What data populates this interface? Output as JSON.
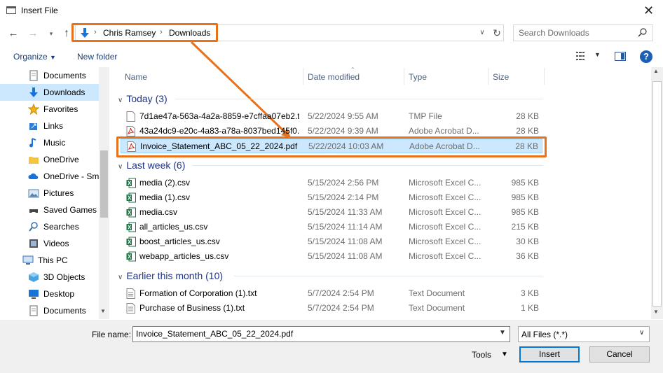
{
  "window": {
    "title": "Insert File",
    "close_glyph": "✕"
  },
  "address": {
    "crumbs": [
      "Chris Ramsey",
      "Downloads"
    ],
    "separator": "›",
    "search_placeholder": "Search Downloads"
  },
  "toolbar": {
    "organize": "Organize",
    "new_folder": "New folder"
  },
  "nav": {
    "items": [
      {
        "label": "Documents",
        "icon": "documents-icon"
      },
      {
        "label": "Downloads",
        "icon": "download-icon",
        "selected": true
      },
      {
        "label": "Favorites",
        "icon": "star-icon"
      },
      {
        "label": "Links",
        "icon": "link-icon"
      },
      {
        "label": "Music",
        "icon": "music-icon"
      },
      {
        "label": "OneDrive",
        "icon": "folder-icon"
      },
      {
        "label": "OneDrive - Sm",
        "icon": "cloud-icon"
      },
      {
        "label": "Pictures",
        "icon": "pictures-icon"
      },
      {
        "label": "Saved Games",
        "icon": "game-icon"
      },
      {
        "label": "Searches",
        "icon": "search-icon"
      },
      {
        "label": "Videos",
        "icon": "video-icon"
      },
      {
        "label": "This PC",
        "icon": "computer-icon"
      },
      {
        "label": "3D Objects",
        "icon": "cube-icon"
      },
      {
        "label": "Desktop",
        "icon": "desktop-icon"
      },
      {
        "label": "Documents",
        "icon": "documents-icon"
      }
    ]
  },
  "columns": {
    "name": "Name",
    "date": "Date modified",
    "type": "Type",
    "size": "Size"
  },
  "groups": [
    {
      "label": "Today (3)"
    },
    {
      "label": "Last week (6)"
    },
    {
      "label": "Earlier this month (10)"
    }
  ],
  "files": [
    {
      "name": "7d1ae47a-563a-4a2a-8859-e7cffaa07eb2.t...",
      "date": "5/22/2024 9:55 AM",
      "type": "TMP File",
      "size": "28 KB",
      "icon": "file-icon"
    },
    {
      "name": "43a24dc9-e20c-4a83-a78a-8037bed145f0...",
      "date": "5/22/2024 9:39 AM",
      "type": "Adobe Acrobat D...",
      "size": "28 KB",
      "icon": "pdf-icon"
    },
    {
      "name": "Invoice_Statement_ABC_05_22_2024.pdf",
      "date": "5/22/2024 10:03 AM",
      "type": "Adobe Acrobat D...",
      "size": "28 KB",
      "icon": "pdf-icon",
      "selected": true
    },
    {
      "name": "media (2).csv",
      "date": "5/15/2024 2:56 PM",
      "type": "Microsoft Excel C...",
      "size": "985 KB",
      "icon": "excel-icon"
    },
    {
      "name": "media (1).csv",
      "date": "5/15/2024 2:14 PM",
      "type": "Microsoft Excel C...",
      "size": "985 KB",
      "icon": "excel-icon"
    },
    {
      "name": "media.csv",
      "date": "5/15/2024 11:33 AM",
      "type": "Microsoft Excel C...",
      "size": "985 KB",
      "icon": "excel-icon"
    },
    {
      "name": "all_articles_us.csv",
      "date": "5/15/2024 11:14 AM",
      "type": "Microsoft Excel C...",
      "size": "215 KB",
      "icon": "excel-icon"
    },
    {
      "name": "boost_articles_us.csv",
      "date": "5/15/2024 11:08 AM",
      "type": "Microsoft Excel C...",
      "size": "30 KB",
      "icon": "excel-icon"
    },
    {
      "name": "webapp_articles_us.csv",
      "date": "5/15/2024 11:08 AM",
      "type": "Microsoft Excel C...",
      "size": "36 KB",
      "icon": "excel-icon"
    },
    {
      "name": "Formation of Corporation (1).txt",
      "date": "5/7/2024 2:54 PM",
      "type": "Text Document",
      "size": "3 KB",
      "icon": "text-file-icon"
    },
    {
      "name": "Purchase of Business (1).txt",
      "date": "5/7/2024 2:54 PM",
      "type": "Text Document",
      "size": "1 KB",
      "icon": "text-file-icon"
    }
  ],
  "footer": {
    "file_name_label": "File name:",
    "file_name_value": "Invoice_Statement_ABC_05_22_2024.pdf",
    "filter": "All Files (*.*)",
    "tools": "Tools",
    "insert": "Insert",
    "cancel": "Cancel"
  },
  "colors": {
    "accent": "#0078d7",
    "highlight": "#e8711c",
    "selection": "#cce8ff",
    "group": "#1e3287"
  }
}
